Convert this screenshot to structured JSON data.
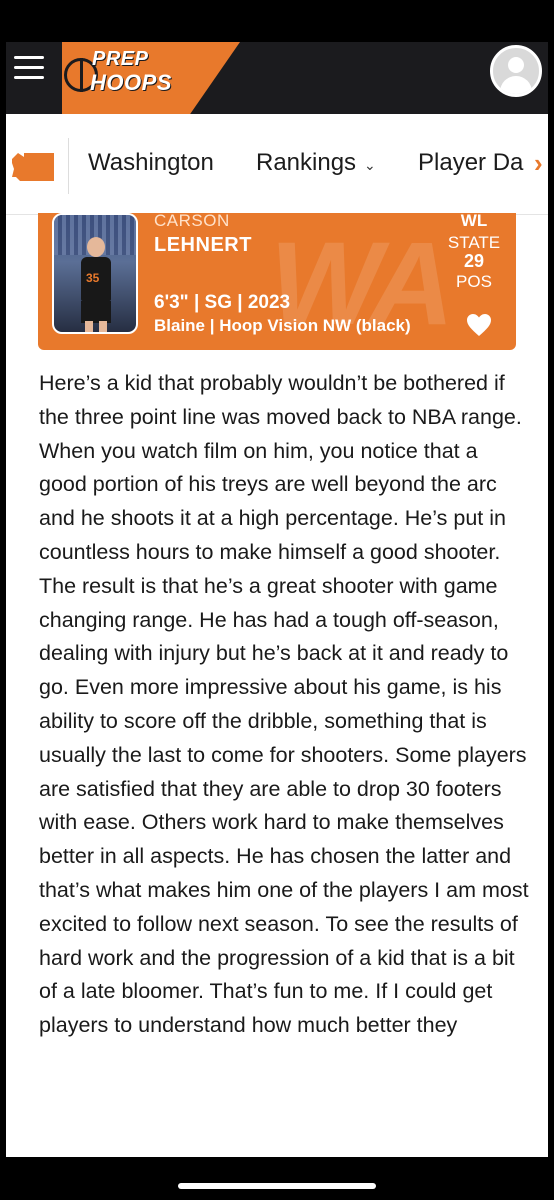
{
  "header": {
    "logo_line1": "PREP",
    "logo_line2": "HOOPS",
    "menu_icon": "hamburger-menu-icon",
    "avatar_icon": "user-avatar-icon",
    "accent_color": "#e8792c",
    "bar_color": "#1b1b1e"
  },
  "nav": {
    "state_icon": "washington-state-icon",
    "items": [
      {
        "label": "Washington"
      },
      {
        "label": "Rankings"
      },
      {
        "label": "Player Da"
      }
    ],
    "next_icon": "chevron-right-icon"
  },
  "player_card": {
    "first_name": "CARSON",
    "last_name": "LEHNERT",
    "jersey_number": "35",
    "watermark": "WA",
    "ranking": {
      "rank_label": "WL",
      "scope": "STATE",
      "value": "29",
      "pos_label": "POS"
    },
    "measurables": "6'3\" | SG | 2023",
    "school_team": "Blaine | Hoop Vision NW (black)",
    "favorite_icon": "heart-icon"
  },
  "article": {
    "body": "Here’s a kid that probably wouldn’t be bothered if the three point line was moved back to NBA range. When you watch film on him, you notice that a good portion of his treys are well beyond the arc and he shoots it at a high percentage. He’s put in countless hours to make himself a good shooter. The result is that he’s a great shooter with game changing range. He has had a tough off-season, dealing with injury but he’s back at it and ready to go. Even more impressive about his game, is his ability to score off the dribble, something that is usually the last to come for shooters. Some players are satisfied that they are able to drop 30 footers with ease. Others work hard to make themselves better in all aspects. He has chosen the latter and that’s what makes him one of the players I am most excited to follow next season. To see the results of hard work and the progression of a kid that is a bit of a late bloomer. That’s fun to me. If I could get players to understand how much better they"
  }
}
